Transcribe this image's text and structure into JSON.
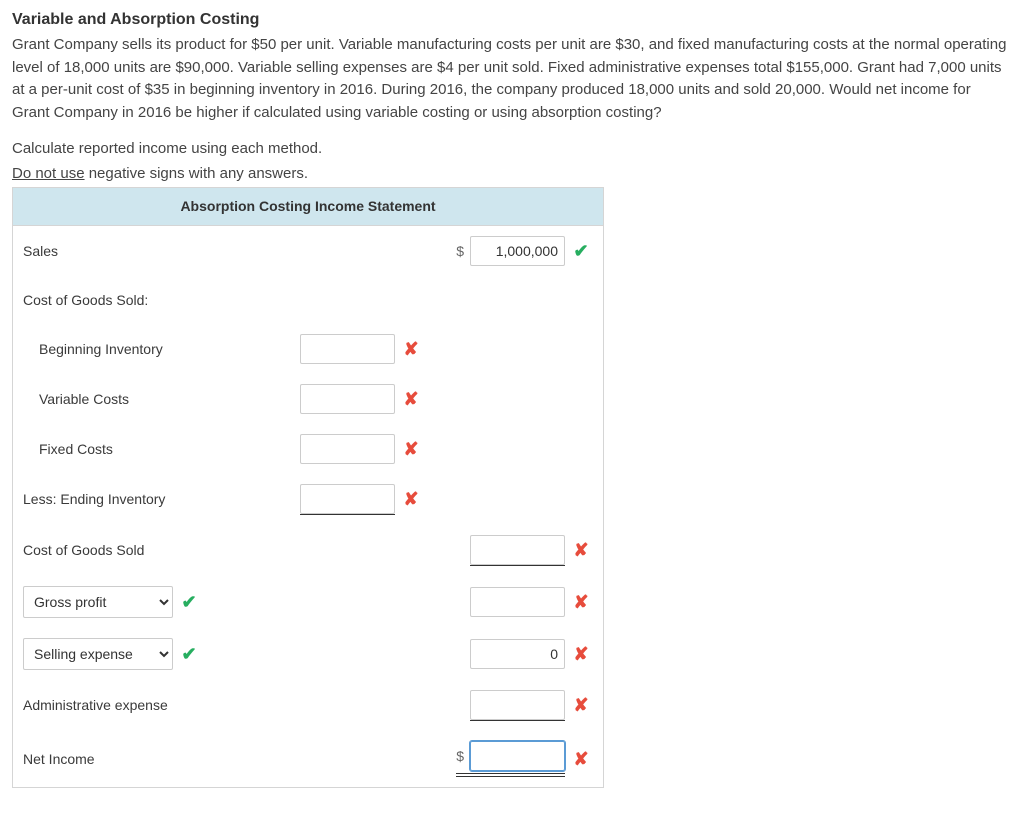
{
  "title": "Variable and Absorption Costing",
  "problem": "Grant Company sells its product for $50 per unit. Variable manufacturing costs per unit are $30, and fixed manufacturing costs at the normal operating level of 18,000 units are $90,000. Variable selling expenses are $4 per unit sold. Fixed administrative expenses total $155,000. Grant had 7,000 units at a per-unit cost of $35 in beginning inventory in 2016. During 2016, the company produced 18,000 units and sold 20,000. Would net income for Grant Company in 2016 be higher if calculated using variable costing or using absorption costing?",
  "instruction1": "Calculate reported income using each method.",
  "instruction2_prefix": "Do not use",
  "instruction2_suffix": " negative signs with any answers.",
  "table_header": "Absorption Costing Income Statement",
  "rows": {
    "sales": {
      "label": "Sales",
      "value": "1,000,000"
    },
    "cogs_header": {
      "label": "Cost of Goods Sold:"
    },
    "beginning_inventory": {
      "label": "Beginning Inventory",
      "value": ""
    },
    "variable_costs": {
      "label": "Variable Costs",
      "value": ""
    },
    "fixed_costs": {
      "label": "Fixed Costs",
      "value": ""
    },
    "less_ending": {
      "label": "Less: Ending Inventory",
      "value": ""
    },
    "cogs": {
      "label": "Cost of Goods Sold",
      "value": ""
    },
    "gross_profit": {
      "selected": "Gross profit",
      "value": ""
    },
    "selling_expense": {
      "selected": "Selling expense",
      "value": "0"
    },
    "admin_expense": {
      "label": "Administrative expense",
      "value": ""
    },
    "net_income": {
      "label": "Net Income",
      "value": ""
    }
  }
}
